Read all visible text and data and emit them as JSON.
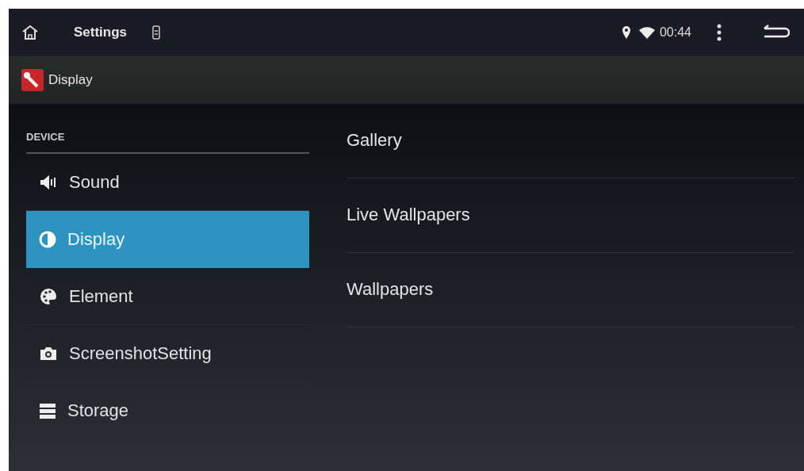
{
  "status_bar": {
    "title": "Settings",
    "time": "00:44"
  },
  "action_bar": {
    "title": "Display"
  },
  "sidebar": {
    "header": "DEVICE",
    "items": [
      {
        "label": "Sound",
        "kind": "sound",
        "selected": false
      },
      {
        "label": "Display",
        "kind": "display",
        "selected": true
      },
      {
        "label": "Element",
        "kind": "palette",
        "selected": false
      },
      {
        "label": "ScreenshotSetting",
        "kind": "camera",
        "selected": false
      },
      {
        "label": "Storage",
        "kind": "storage",
        "selected": false
      }
    ]
  },
  "options": [
    "Gallery",
    "Live Wallpapers",
    "Wallpapers"
  ]
}
